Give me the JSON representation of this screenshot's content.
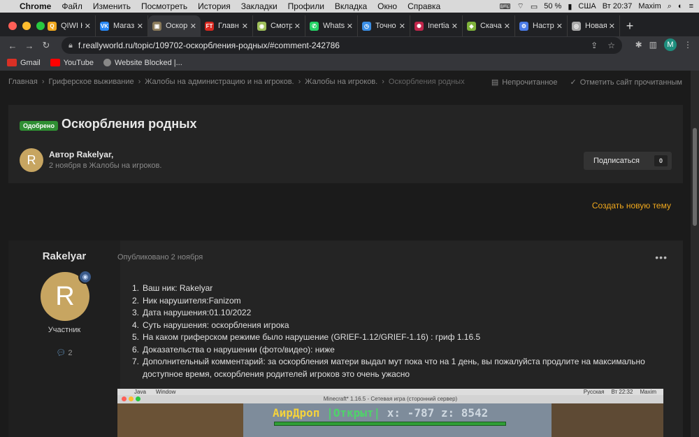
{
  "menubar": {
    "app": "Chrome",
    "items": [
      "Файл",
      "Изменить",
      "Посмотреть",
      "История",
      "Закладки",
      "Профили",
      "Вкладка",
      "Окно",
      "Справка"
    ],
    "battery": "50 %",
    "input_source": "США",
    "clock": "Вт 20:37",
    "user": "Maxim"
  },
  "tabs": [
    {
      "label": "QIWI Н",
      "color": "#f0a81d",
      "glyph": "Q"
    },
    {
      "label": "Магаз",
      "color": "#2787f5",
      "glyph": "VK"
    },
    {
      "label": "Оскорб",
      "color": "#8a7a5a",
      "glyph": "▣"
    },
    {
      "label": "Главн",
      "color": "#d8281f",
      "glyph": "FT"
    },
    {
      "label": "Смотр",
      "color": "#9fbf5a",
      "glyph": "◉"
    },
    {
      "label": "Whats",
      "color": "#25d366",
      "glyph": "✆"
    },
    {
      "label": "Точно",
      "color": "#3a8ee6",
      "glyph": "◷"
    },
    {
      "label": "Inertia",
      "color": "#c0264b",
      "glyph": "✺"
    },
    {
      "label": "Скача",
      "color": "#7fb23a",
      "glyph": "◆"
    },
    {
      "label": "Настр",
      "color": "#4a7be8",
      "glyph": "⚙"
    },
    {
      "label": "Новая",
      "color": "#aaaaaa",
      "glyph": "◎"
    }
  ],
  "address": {
    "url": "f.reallyworld.ru/topic/109702-оскорбления-родных/#comment-242786"
  },
  "profile_initial": "M",
  "bookmarks": [
    {
      "label": "Gmail",
      "color": "#d93025"
    },
    {
      "label": "YouTube",
      "color": "#ff0000"
    },
    {
      "label": "Website Blocked |...",
      "color": "#888888"
    }
  ],
  "breadcrumb": {
    "items": [
      "Главная",
      "Гриферское выживание",
      "Жалобы на администрацию и на игроков.",
      "Жалобы на игроков."
    ],
    "current": "Оскорбления родных",
    "unread": "Непрочитанное",
    "mark_read": "Отметить сайт прочитанным"
  },
  "topic": {
    "badge": "Одобрено",
    "title": "Оскорбления родных",
    "avatar_initial": "R",
    "author": "Автор Rakelyar,",
    "meta": "2 ноября в Жалобы на игроков.",
    "subscribe": "Подписаться",
    "subscribers": "0"
  },
  "create_topic": "Создать новую тему",
  "post": {
    "username": "Rakelyar",
    "avatar_initial": "R",
    "role": "Участник",
    "post_count": "2",
    "published": "Опубликовано 2 ноября",
    "more": "•••",
    "items": [
      "Ваш ник: Rakelyar",
      "Ник нарушителя:Fanizom",
      "Дата нарушения:01.10/2022",
      "Суть нарушения: оскорбления игрока",
      "На каком гриферском режиме было нарушение (GRIEF-1.12/GRIEF-1.16) : гриф 1.16.5",
      "Доказательства о нарушении (фото/видео): ниже",
      "Дополнительный комментарий: за оскорбления матери выдал мут пока что на 1 день, вы пожалуйста продлите на максимально доступное время, оскорбления родителей игроков это очень ужасно"
    ]
  },
  "embed": {
    "mac_items": [
      "Java",
      "Window"
    ],
    "mac_lang": "Русская",
    "mac_clock": "Вт 22:32",
    "mac_user": "Maxim",
    "window_title": "Minecraft* 1.16.5 - Сетевая игра (сторонний сервер)",
    "hud_a": "АирДроп",
    "hud_b": "|Открыт|",
    "hud_c": "x: -787 z: 8542"
  }
}
